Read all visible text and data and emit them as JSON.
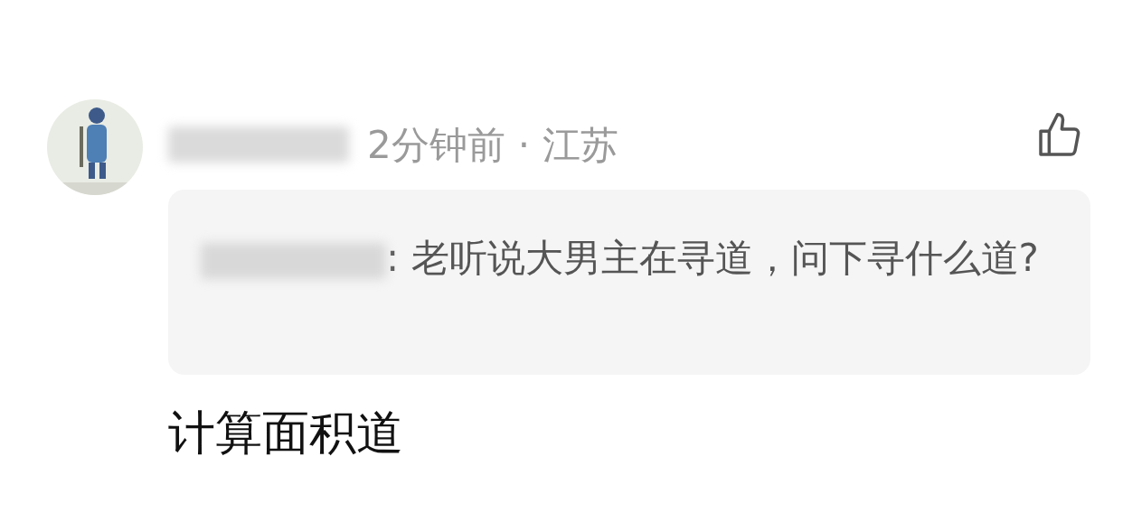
{
  "comment": {
    "time": "2分钟前",
    "separator": "·",
    "location": "江苏",
    "liked": false,
    "quote": {
      "text": ": 老听说大男主在寻道，问下寻什么道?"
    },
    "reply": "计算面积道"
  }
}
